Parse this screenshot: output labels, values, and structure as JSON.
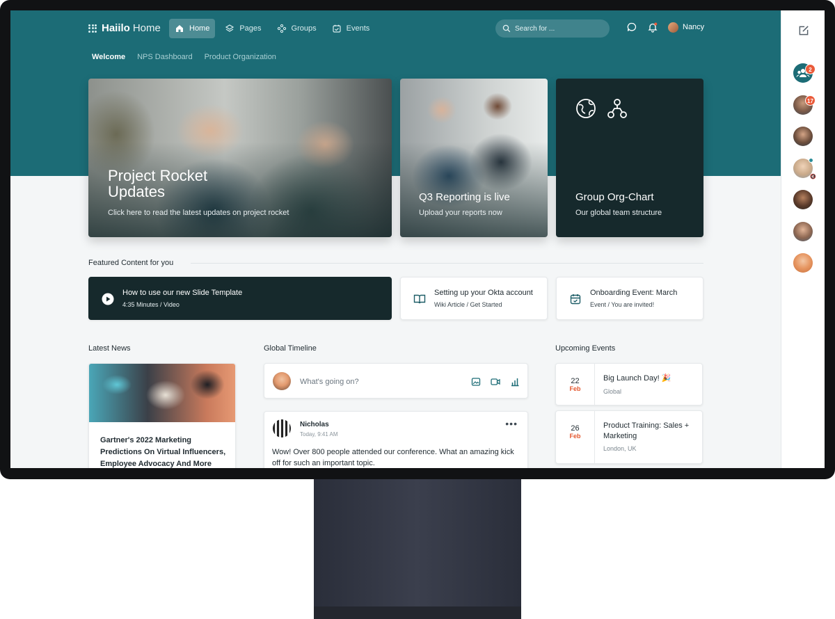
{
  "brand": {
    "name_bold": "Haiilo",
    "name_light": "Home"
  },
  "nav": [
    {
      "label": "Home",
      "icon": "home-icon",
      "active": true
    },
    {
      "label": "Pages",
      "icon": "layers-icon"
    },
    {
      "label": "Groups",
      "icon": "groups-icon"
    },
    {
      "label": "Events",
      "icon": "calendar-icon"
    }
  ],
  "search": {
    "placeholder": "Search for ..."
  },
  "user": {
    "name": "Nancy"
  },
  "subnav": [
    {
      "label": "Welcome",
      "active": true
    },
    {
      "label": "NPS Dashboard"
    },
    {
      "label": "Product Organization"
    }
  ],
  "hero": [
    {
      "title_line1": "Project Rocket",
      "title_line2": "Updates",
      "subtitle": "Click here to read the latest updates on project rocket"
    },
    {
      "title": "Q3 Reporting is live",
      "subtitle": "Upload your reports now"
    },
    {
      "title": "Group Org-Chart",
      "subtitle": "Our global team structure",
      "icons": [
        "globe-icon",
        "org-chart-icon"
      ]
    }
  ],
  "featured": {
    "heading": "Featured Content for you",
    "items": [
      {
        "title": "How to use our new Slide Template",
        "meta": "4:35 Minutes / Video",
        "icon": "play-icon"
      },
      {
        "title": "Setting up your Okta account",
        "meta": "Wiki Article / Get Started",
        "icon": "book-icon"
      },
      {
        "title": "Onboarding Event: March",
        "meta": "Event / You are invited!",
        "icon": "calendar-check-icon"
      }
    ]
  },
  "news": {
    "heading": "Latest News",
    "article": {
      "title": "Gartner's 2022 Marketing Predictions On Virtual Influencers, Employee Advocacy And More"
    }
  },
  "timeline": {
    "heading": "Global Timeline",
    "composer_placeholder": "What's going on?",
    "post": {
      "author": "Nicholas",
      "time": "Today, 9:41 AM",
      "more": "•••",
      "body": "Wow! Over 800 people attended our conference. What an amazing kick off for such an important topic."
    }
  },
  "events": {
    "heading": "Upcoming Events",
    "items": [
      {
        "day": "22",
        "month": "Feb",
        "title": "Big Launch Day! 🎉",
        "location": "Global"
      },
      {
        "day": "26",
        "month": "Feb",
        "title": "Product Training: Sales + Marketing",
        "location": "London, UK"
      }
    ]
  },
  "sidebar": {
    "badges": [
      "2",
      "17"
    ]
  },
  "colors": {
    "brand_teal": "#1c6c76",
    "dark_card": "#16292c",
    "accent_red": "#e4572e"
  }
}
